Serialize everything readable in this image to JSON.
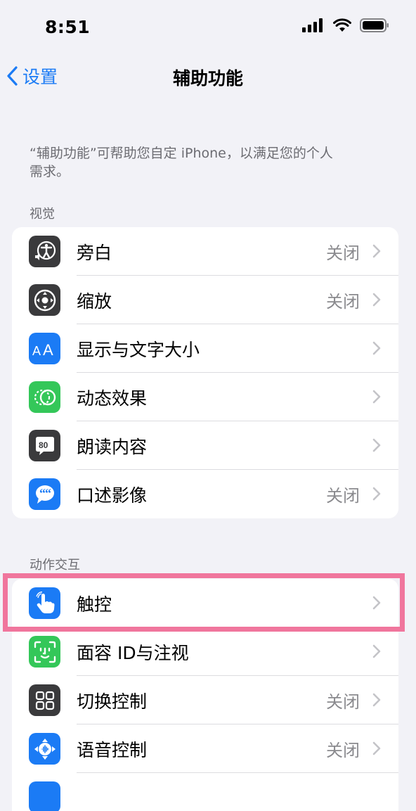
{
  "status_bar": {
    "time": "8:51"
  },
  "nav": {
    "back_label": "设置",
    "title": "辅助功能"
  },
  "description": "“辅助功能”可帮助您自定 iPhone，以满足您的个人需求。",
  "sections": [
    {
      "header": "视觉",
      "items": [
        {
          "label": "旁白",
          "value": "关闭",
          "icon": "voiceover-icon",
          "color": "#3a3a3c"
        },
        {
          "label": "缩放",
          "value": "关闭",
          "icon": "zoom-icon",
          "color": "#3a3a3c"
        },
        {
          "label": "显示与文字大小",
          "value": "",
          "icon": "text-size-icon",
          "color": "#1b7bf5"
        },
        {
          "label": "动态效果",
          "value": "",
          "icon": "motion-icon",
          "color": "#34c759"
        },
        {
          "label": "朗读内容",
          "value": "",
          "icon": "spoken-content-icon",
          "color": "#3a3a3c"
        },
        {
          "label": "口述影像",
          "value": "关闭",
          "icon": "audio-description-icon",
          "color": "#1b7bf5"
        }
      ]
    },
    {
      "header": "动作交互",
      "items": [
        {
          "label": "触控",
          "value": "",
          "icon": "touch-icon",
          "color": "#1b7bf5"
        },
        {
          "label": "面容 ID与注视",
          "value": "",
          "icon": "face-id-icon",
          "color": "#34c759"
        },
        {
          "label": "切换控制",
          "value": "关闭",
          "icon": "switch-control-icon",
          "color": "#3a3a3c"
        },
        {
          "label": "语音控制",
          "value": "关闭",
          "icon": "voice-control-icon",
          "color": "#1b7bf5"
        }
      ]
    }
  ],
  "colors": {
    "accent": "#1b7bf5",
    "highlight": "#f0769d",
    "background": "#f2f2f7"
  }
}
